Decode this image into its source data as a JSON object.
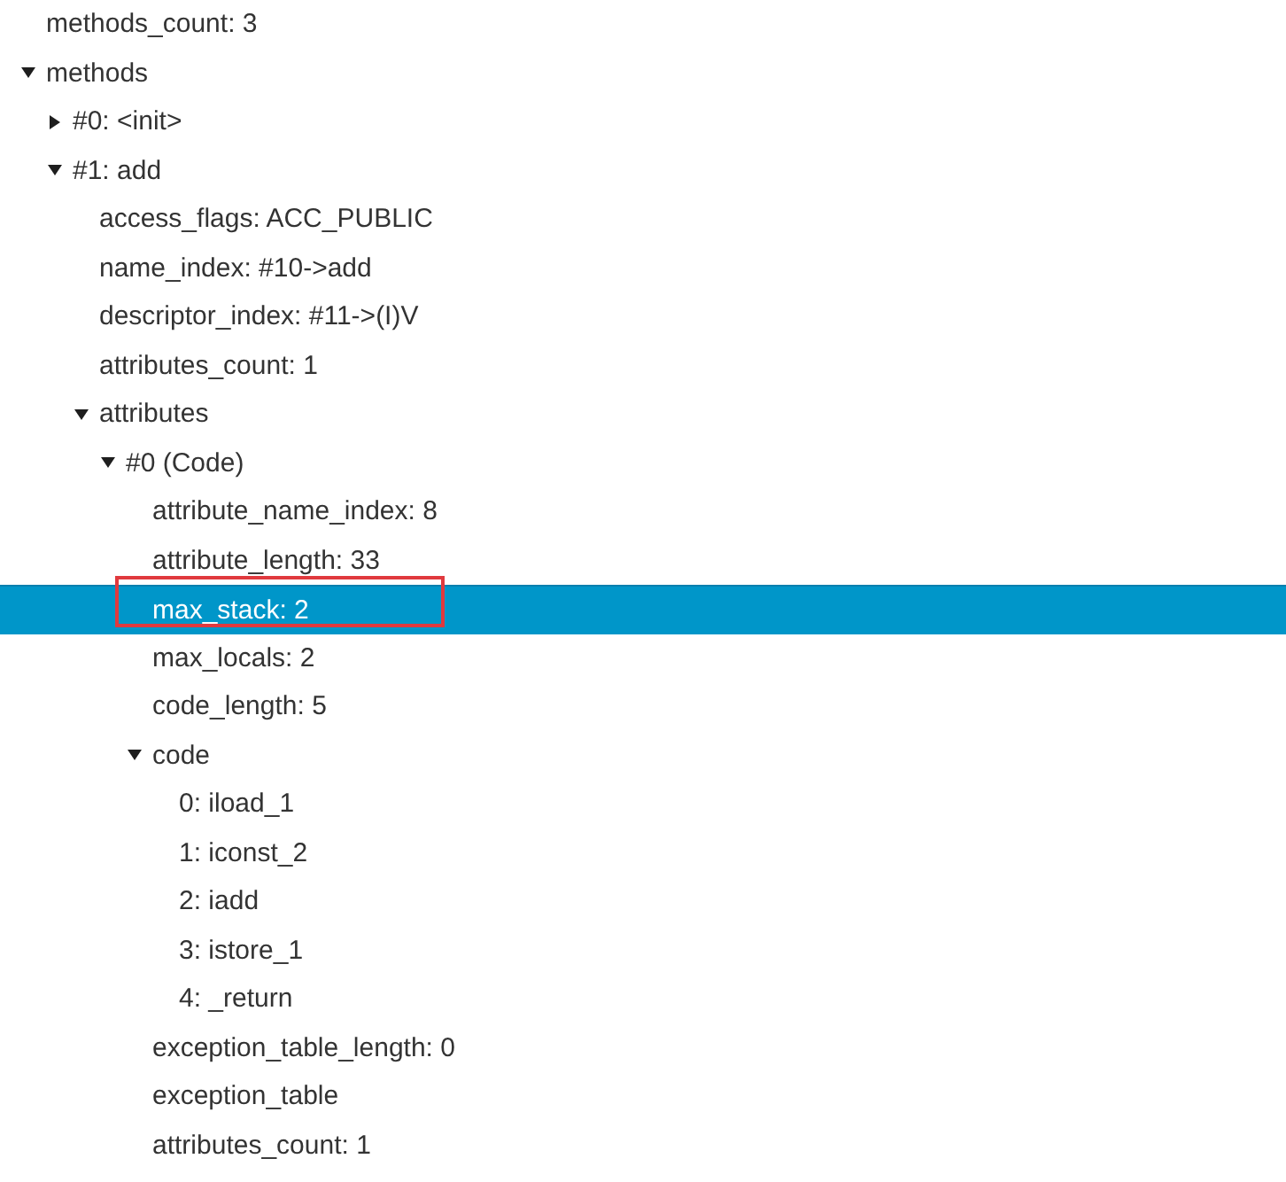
{
  "tree": {
    "nodes": [
      {
        "label": "methods_count: 3",
        "kind": "leaf",
        "selected": false,
        "outlined": false
      },
      {
        "label": "methods",
        "kind": "branch",
        "expanded": true,
        "selected": false,
        "outlined": false,
        "children": [
          {
            "label": "#0: <init>",
            "kind": "branch",
            "expanded": false,
            "selected": false,
            "outlined": false
          },
          {
            "label": "#1: add",
            "kind": "branch",
            "expanded": true,
            "selected": false,
            "outlined": false,
            "children": [
              {
                "label": "access_flags: ACC_PUBLIC",
                "kind": "leaf",
                "selected": false,
                "outlined": false
              },
              {
                "label": "name_index: #10->add",
                "kind": "leaf",
                "selected": false,
                "outlined": false
              },
              {
                "label": "descriptor_index: #11->(I)V",
                "kind": "leaf",
                "selected": false,
                "outlined": false
              },
              {
                "label": "attributes_count: 1",
                "kind": "leaf",
                "selected": false,
                "outlined": false
              },
              {
                "label": "attributes",
                "kind": "branch",
                "expanded": true,
                "selected": false,
                "outlined": false,
                "children": [
                  {
                    "label": "#0 (Code)",
                    "kind": "branch",
                    "expanded": true,
                    "selected": false,
                    "outlined": false,
                    "children": [
                      {
                        "label": "attribute_name_index: 8",
                        "kind": "leaf",
                        "selected": false,
                        "outlined": false
                      },
                      {
                        "label": "attribute_length: 33",
                        "kind": "leaf",
                        "selected": false,
                        "outlined": false
                      },
                      {
                        "label": "max_stack: 2",
                        "kind": "leaf",
                        "selected": true,
                        "outlined": true
                      },
                      {
                        "label": "max_locals: 2",
                        "kind": "leaf",
                        "selected": false,
                        "outlined": false
                      },
                      {
                        "label": "code_length: 5",
                        "kind": "leaf",
                        "selected": false,
                        "outlined": false
                      },
                      {
                        "label": "code",
                        "kind": "branch",
                        "expanded": true,
                        "selected": false,
                        "outlined": false,
                        "children": [
                          {
                            "label": "0: iload_1",
                            "kind": "leaf",
                            "selected": false,
                            "outlined": false
                          },
                          {
                            "label": "1: iconst_2",
                            "kind": "leaf",
                            "selected": false,
                            "outlined": false
                          },
                          {
                            "label": "2: iadd",
                            "kind": "leaf",
                            "selected": false,
                            "outlined": false
                          },
                          {
                            "label": "3: istore_1",
                            "kind": "leaf",
                            "selected": false,
                            "outlined": false
                          },
                          {
                            "label": "4: _return",
                            "kind": "leaf",
                            "selected": false,
                            "outlined": false
                          }
                        ]
                      },
                      {
                        "label": "exception_table_length: 0",
                        "kind": "leaf",
                        "selected": false,
                        "outlined": false
                      },
                      {
                        "label": "exception_table",
                        "kind": "leaf",
                        "selected": false,
                        "outlined": false
                      },
                      {
                        "label": "attributes_count: 1",
                        "kind": "leaf",
                        "selected": false,
                        "outlined": false
                      }
                    ]
                  }
                ]
              }
            ]
          }
        ]
      }
    ]
  }
}
